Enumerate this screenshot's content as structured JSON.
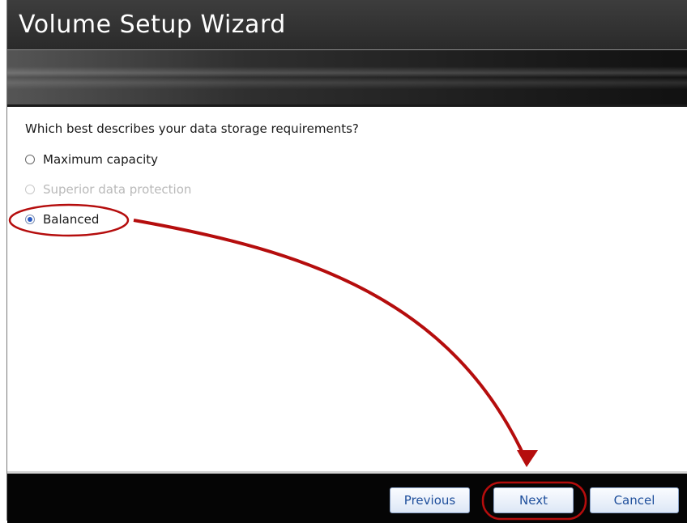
{
  "window": {
    "title": "Volume Setup Wizard"
  },
  "content": {
    "question": "Which best describes your data storage requirements?",
    "options": [
      {
        "label": "Maximum capacity",
        "selected": false,
        "enabled": true
      },
      {
        "label": "Superior data protection",
        "selected": false,
        "enabled": false
      },
      {
        "label": "Balanced",
        "selected": true,
        "enabled": true
      }
    ]
  },
  "footer": {
    "previous_label": "Previous",
    "next_label": "Next",
    "cancel_label": "Cancel"
  },
  "colors": {
    "annotation": "#b50d0d",
    "button_text": "#1f4f9c",
    "title_bar": "#333333"
  }
}
